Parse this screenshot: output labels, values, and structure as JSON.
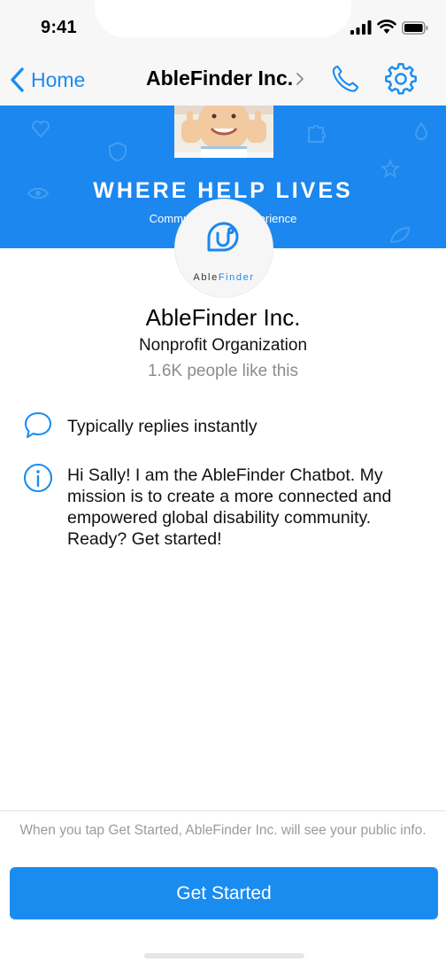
{
  "status_bar": {
    "time": "9:41"
  },
  "nav": {
    "back_label": "Home",
    "title": "AbleFinder Inc.",
    "icons": {
      "back": "chevron-left-icon",
      "title_chevron": "chevron-right-icon",
      "call": "phone-icon",
      "settings": "gear-icon"
    }
  },
  "cover": {
    "headline": "WHERE HELP LIVES",
    "tagline": "Community, s                    l-in experience"
  },
  "logo": {
    "word_part1": "Able",
    "word_part2": "Finder"
  },
  "profile": {
    "name": "AbleFinder Inc.",
    "category": "Nonprofit Organization",
    "likes": "1.6K people like this"
  },
  "info": {
    "response_time": "Typically replies instantly",
    "response_icon": "chat-bubble-icon",
    "about": "Hi Sally! I am the AbleFinder Chatbot. My mission is to create a more connected and empowered global disability community. Ready? Get started!",
    "about_icon": "info-icon"
  },
  "footer": {
    "disclaimer": "When you tap Get Started, AbleFinder Inc. will see your public info.",
    "cta_label": "Get Started"
  },
  "colors": {
    "accent": "#1a8cf0",
    "cover_bg": "#1c87ee",
    "muted_text": "#8c8c8c",
    "bar_bg": "#f7f7f7"
  }
}
